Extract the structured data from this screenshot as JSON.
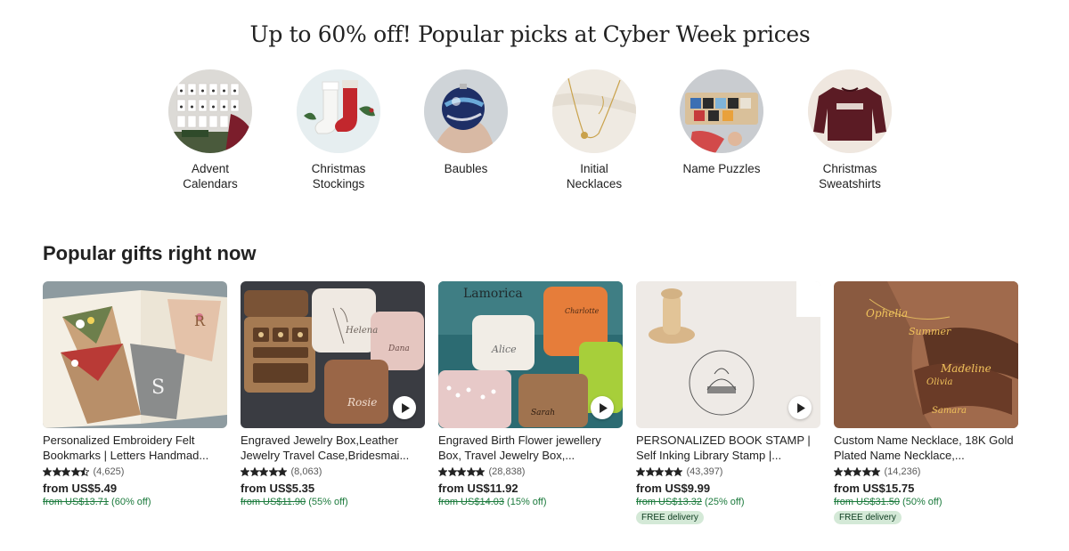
{
  "promo": {
    "title": "Up to 60% off! Popular picks at Cyber Week prices"
  },
  "categories": [
    {
      "label": "Advent\nCalendars",
      "icon": "advent-calendar-image"
    },
    {
      "label": "Christmas\nStockings",
      "icon": "christmas-stocking-image"
    },
    {
      "label": "Baubles",
      "icon": "bauble-image"
    },
    {
      "label": "Initial\nNecklaces",
      "icon": "initial-necklace-image"
    },
    {
      "label": "Name Puzzles",
      "icon": "name-puzzle-image"
    },
    {
      "label": "Christmas\nSweatshirts",
      "icon": "christmas-sweatshirt-image"
    }
  ],
  "section": {
    "title": "Popular gifts right now"
  },
  "products": [
    {
      "title": "Personalized Embroidery Felt Bookmarks | Letters Handmad...",
      "rating": 4.5,
      "reviews": "(4,625)",
      "price": "from US$5.49",
      "original": "from US$13.71",
      "discount": "(60% off)",
      "badge": "",
      "video": false
    },
    {
      "title": "Engraved Jewelry Box,Leather Jewelry Travel Case,Bridesmai...",
      "rating": 5,
      "reviews": "(8,063)",
      "price": "from US$5.35",
      "original": "from US$11.90",
      "discount": "(55% off)",
      "badge": "",
      "video": true
    },
    {
      "title": "Engraved Birth Flower jewellery Box, Travel Jewelry Box,...",
      "rating": 5,
      "reviews": "(28,838)",
      "price": "from US$11.92",
      "original": "from US$14.03",
      "discount": "(15% off)",
      "badge": "",
      "video": true
    },
    {
      "title": "PERSONALIZED BOOK STAMP | Self Inking Library Stamp |...",
      "rating": 5,
      "reviews": "(43,397)",
      "price": "from US$9.99",
      "original": "from US$13.32",
      "discount": "(25% off)",
      "badge": "FREE delivery",
      "video": true
    },
    {
      "title": "Custom Name Necklace, 18K Gold Plated Name Necklace,...",
      "rating": 5,
      "reviews": "(14,236)",
      "price": "from US$15.75",
      "original": "from US$31.50",
      "discount": "(50% off)",
      "badge": "FREE delivery",
      "video": false
    }
  ],
  "colors": {
    "star": "#222222",
    "sale_green": "#1b7a3c",
    "badge_bg": "#d4e9d7"
  }
}
